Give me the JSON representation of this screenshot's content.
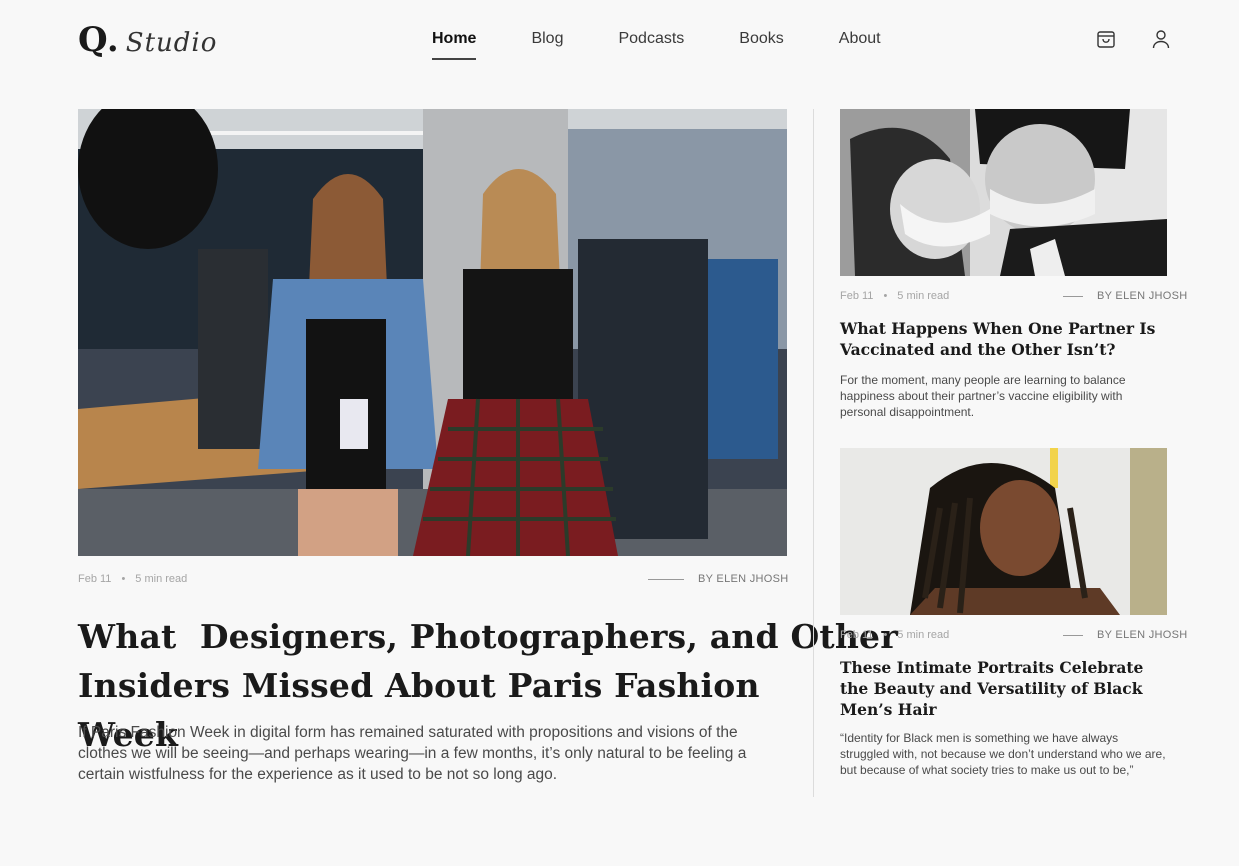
{
  "logo": {
    "mark": "Q.",
    "script": "Studio"
  },
  "nav": {
    "items": [
      {
        "label": "Home",
        "active": true
      },
      {
        "label": "Blog"
      },
      {
        "label": "Podcasts"
      },
      {
        "label": "Books"
      },
      {
        "label": "About"
      }
    ]
  },
  "header_icons": [
    "shopping-bag-icon",
    "user-icon"
  ],
  "main_article": {
    "date": "Feb 11",
    "read_time": "5 min read",
    "author": "BY ELEN JHOSH",
    "title_line1": "What  Designers, Photographers, and Other",
    "title_line2": "Insiders Missed About Paris Fashion Week",
    "excerpt": "If Paris Fashion Week in digital form has remained saturated with propositions and visions of the clothes we will be seeing—and perhaps wearing—in a few months, it’s only natural to be feeling a certain wistfulness for the experience as it used to be not so long ago."
  },
  "side_articles": [
    {
      "date": "Feb 11",
      "read_time": "5 min read",
      "author": "BY ELEN JHOSH",
      "title": "What Happens When One Partner Is Vaccinated and the Other Isn’t?",
      "excerpt": "For the moment, many people are learning to balance happiness about their partner’s vaccine eligibility with personal disappointment."
    },
    {
      "date": "Feb 11",
      "read_time": "5 min read",
      "author": "BY ELEN JHOSH",
      "title": "These Intimate Portraits Celebrate the Beauty and Versatility of Black Men’s Hair",
      "excerpt": "“Identity for Black men is something we have always struggled with, not because we don’t understand who we are, but because of what society tries to make us out to be,”"
    }
  ],
  "colors": {
    "background": "#f8f8f8",
    "text": "#1a1a1a",
    "muted": "#a5a5a5"
  }
}
